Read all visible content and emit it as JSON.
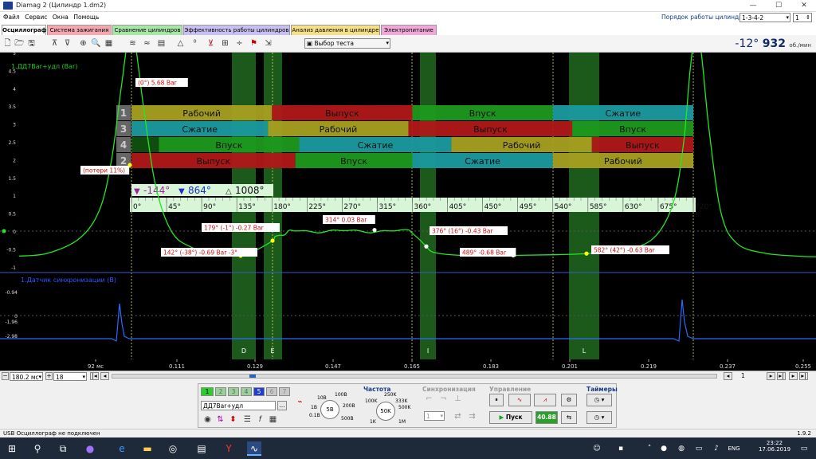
{
  "window": {
    "title": "Diamag 2 (Цилиндр 1.dm2)"
  },
  "menu": [
    "Файл",
    "Сервис",
    "Окна",
    "Помощь"
  ],
  "firing_order": {
    "label": "Порядок работы цилиндров",
    "value": "1-3-4-2",
    "cyl": "1"
  },
  "tabs": [
    {
      "label": "Осциллограф",
      "color": "#ffffff"
    },
    {
      "label": "Система зажигания",
      "color": "#f2a8b0"
    },
    {
      "label": "Сравнение цилиндров",
      "color": "#a8e6a8"
    },
    {
      "label": "Эффективность работы цилиндров",
      "color": "#c8c0f0"
    },
    {
      "label": "Анализ давления в цилиндре",
      "color": "#f5e08a"
    },
    {
      "label": "Электропитание",
      "color": "#f0a8d8"
    }
  ],
  "toolbar": {
    "select_test": "Выбор теста"
  },
  "rpm": {
    "angle": "-12°",
    "value": "932",
    "unit": "об./мин"
  },
  "channel1": {
    "label": "1.ДД7Вar+удл (Bar)",
    "y_ticks": [
      "6",
      "5.5",
      "5",
      "4.5",
      "4",
      "3.5",
      "3",
      "2.5",
      "2",
      "1.5",
      "1",
      "0.5",
      "0",
      "-0.5",
      "-1"
    ],
    "y_vals": [
      6,
      5.5,
      5,
      4.5,
      4,
      3.5,
      3,
      2.5,
      2,
      1.5,
      1,
      0.5,
      0,
      -0.5,
      -1
    ]
  },
  "channel2": {
    "label": "1.Датчик синхронизации (В)",
    "y_ticks": [
      "-0.94",
      "-1.96",
      "-2.98",
      "0"
    ]
  },
  "markers": {
    "a": "-144°",
    "b": "864°",
    "c": "1008°"
  },
  "angle_scale": [
    "0°",
    "45°",
    "90°",
    "135°",
    "180°",
    "225°",
    "270°",
    "315°",
    "360°",
    "405°",
    "450°",
    "495°",
    "540°",
    "585°",
    "630°",
    "675°",
    "720°"
  ],
  "cyl_rows": [
    {
      "num": "1",
      "strokes": [
        "Рабочий",
        "Выпуск",
        "Впуск",
        "Сжатие"
      ]
    },
    {
      "num": "3",
      "strokes": [
        "Сжатие",
        "Рабочий",
        "Выпуск",
        "Впуск"
      ]
    },
    {
      "num": "4",
      "strokes": [
        "Впуск",
        "Сжатие",
        "Рабочий",
        "Выпуск"
      ]
    },
    {
      "num": "2",
      "strokes": [
        "Выпуск",
        "Впуск",
        "Сжатие",
        "Рабочий"
      ]
    }
  ],
  "stroke_colors": {
    "Рабочий": "#a8a020",
    "Выпуск": "#b01818",
    "Впуск": "#1e9a1e",
    "Сжатие": "#1a9aa0"
  },
  "annotations": [
    "(0°) 5.68 Bar",
    "(потери 11%)",
    "179° (-1°) -0.27 Bar",
    "314° 0.03 Bar",
    "376° (16°) -0.43 Bar",
    "142° (-38°) -0.69 Bar -3°",
    "489° -0.68 Bar",
    "582° (42°) -0.63 Bar"
  ],
  "zone_labels": [
    "D",
    "E",
    "I",
    "L"
  ],
  "time_ticks": [
    "92 мс",
    "0.111",
    "0.129",
    "0.147",
    "0.165",
    "0.183",
    "0.201",
    "0.219",
    "0.237",
    "0.255"
  ],
  "bottom": {
    "timebase": "180.2 мс",
    "channel": "18",
    "page": "1"
  },
  "controls": {
    "channel_buttons": [
      "1",
      "2",
      "3",
      "4",
      "5",
      "6",
      "7"
    ],
    "probe": "ДД7Вar+удл",
    "range_labels": [
      "10В",
      "100В",
      "200В",
      "5В",
      "0.1В",
      "500В",
      "1В"
    ],
    "freq_title": "Частота",
    "freq_labels": [
      "250K",
      "100K",
      "333K",
      "500K",
      "50K",
      "1K",
      "1M"
    ],
    "sync_title": "Синхронизация",
    "sync_value": "1",
    "ctrl_title": "Управление",
    "start": "Пуск",
    "fps": "40.88",
    "timers_title": "Таймеры"
  },
  "status": {
    "text": "USB Осциллограф не подключен",
    "version": "1.9.2"
  },
  "taskbar": {
    "time": "23:22",
    "date": "17.06.2019",
    "lang": "ENG"
  }
}
